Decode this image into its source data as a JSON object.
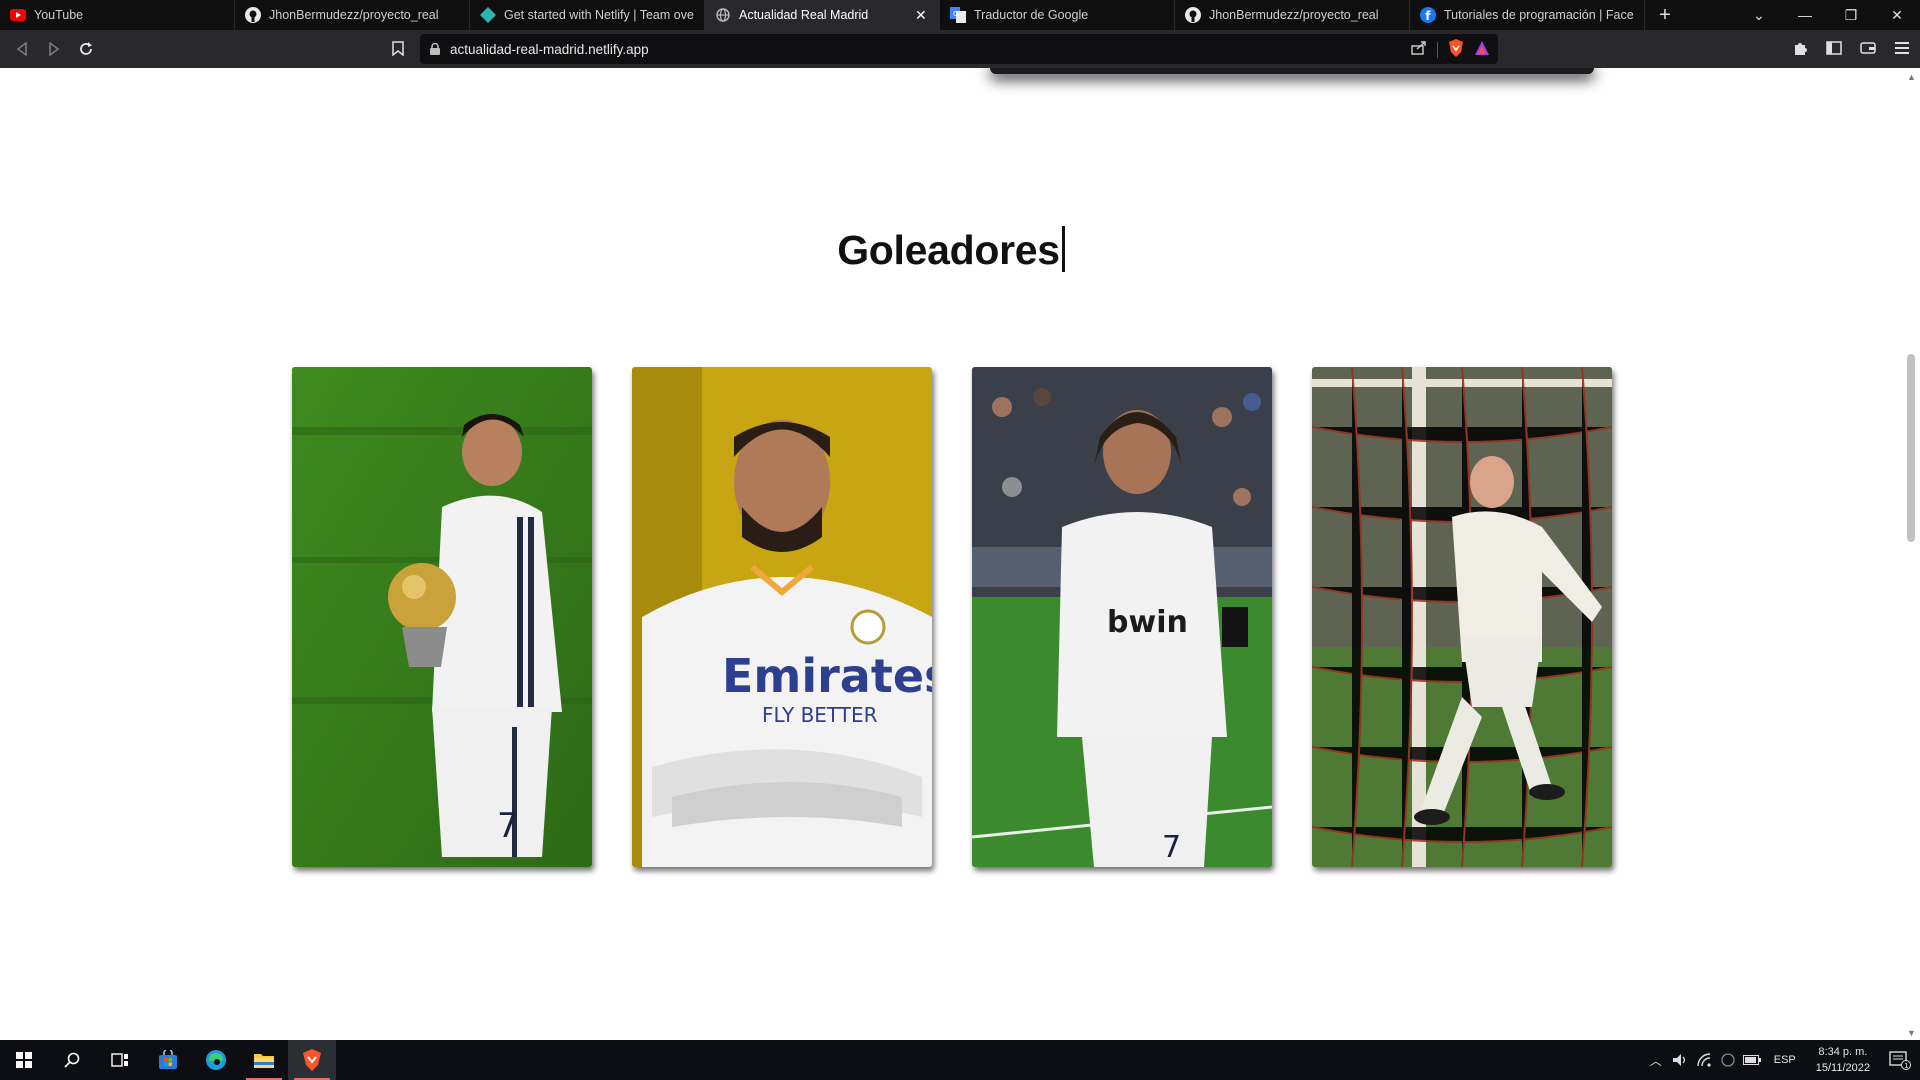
{
  "browser": {
    "tabs": [
      {
        "title": "YouTube",
        "icon": "youtube-icon",
        "active": false
      },
      {
        "title": "JhonBermudezz/proyecto_real",
        "icon": "github-icon",
        "active": false
      },
      {
        "title": "Get started with Netlify | Team overvie",
        "icon": "netlify-icon",
        "active": false
      },
      {
        "title": "Actualidad Real Madrid",
        "icon": "globe-icon",
        "active": true
      },
      {
        "title": "Traductor de Google",
        "icon": "google-translate-icon",
        "active": false
      },
      {
        "title": "JhonBermudezz/proyecto_real",
        "icon": "github-icon",
        "active": false
      },
      {
        "title": "Tutoriales de programación | Facebo",
        "icon": "facebook-icon",
        "active": false
      }
    ],
    "new_tab_label": "+",
    "url": "actualidad-real-madrid.netlify.app"
  },
  "page": {
    "section_title": "Goleadores",
    "cards": [
      {
        "player_photo": "card-1"
      },
      {
        "player_photo": "card-2"
      },
      {
        "player_photo": "card-3"
      },
      {
        "player_photo": "card-4"
      }
    ]
  },
  "taskbar": {
    "language": "ESP",
    "time": "8:34 p. m.",
    "date": "15/11/2022",
    "notifications_count": "1"
  },
  "colors": {
    "tab_strip": "#0f0f10",
    "toolbar": "#29292d",
    "taskbar": "#0c0e14",
    "heading": "#111111"
  }
}
